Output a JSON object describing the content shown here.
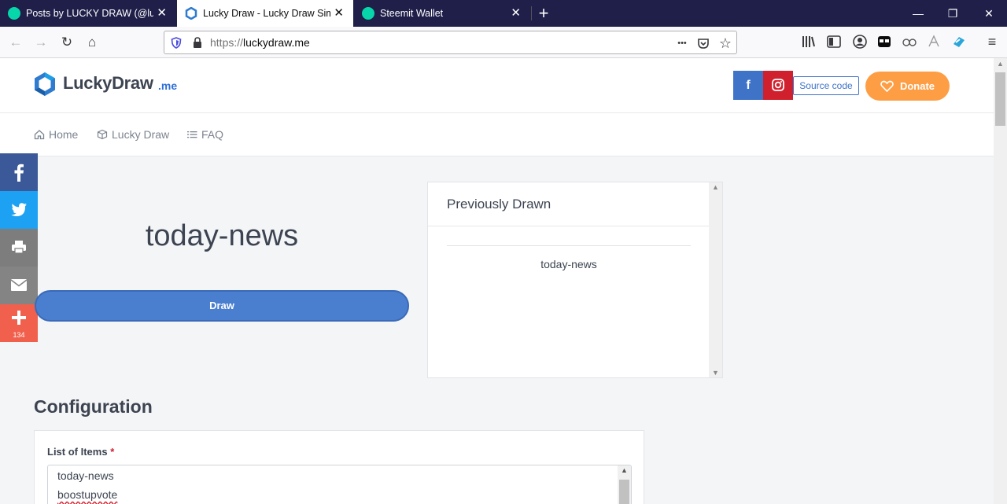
{
  "browser": {
    "tabs": [
      {
        "title": "Posts by LUCKY DRAW (@lucky",
        "close": "✕"
      },
      {
        "title": "Lucky Draw - Lucky Draw Simul",
        "close": "✕"
      },
      {
        "title": "Steemit Wallet",
        "close": "✕"
      }
    ],
    "new_tab": "+",
    "window_controls": {
      "minimize": "—",
      "restore": "❐",
      "close": "✕"
    },
    "nav": {
      "back": "←",
      "forward": "→",
      "reload": "↻",
      "home": "⌂"
    },
    "url": {
      "protocol": "https://",
      "host": "luckydraw.me"
    },
    "url_actions": {
      "more": "•••",
      "pocket": "◡",
      "bookmark": "☆"
    },
    "toolbar_icons": [
      "library-icon",
      "sidebar-icon",
      "account-icon",
      "extension-icon",
      "extension-icon",
      "extension-icon",
      "extension-icon"
    ],
    "menu": "≡"
  },
  "header": {
    "logo_text": "LuckyDraw",
    "logo_suffix": ".me",
    "facebook_label": "f",
    "source_code_label": "Source code",
    "donate_label": "Donate"
  },
  "menu": {
    "items": [
      {
        "label": "Home",
        "icon": "home-icon"
      },
      {
        "label": "Lucky Draw",
        "icon": "box-icon"
      },
      {
        "label": "FAQ",
        "icon": "list-icon"
      }
    ]
  },
  "share_bar": {
    "buttons": [
      {
        "name": "facebook",
        "color": "#3b5998"
      },
      {
        "name": "twitter",
        "color": "#1da1f2"
      },
      {
        "name": "print",
        "color": "#7d7d7d"
      },
      {
        "name": "email",
        "color": "#848484"
      },
      {
        "name": "more",
        "color": "#f0604d"
      }
    ],
    "count": "134"
  },
  "main": {
    "current_item": "today-news",
    "draw_button": "Draw"
  },
  "previously_drawn": {
    "title": "Previously Drawn",
    "items": [
      "today-news"
    ]
  },
  "configuration": {
    "title": "Configuration",
    "list_label": "List of Items",
    "required_mark": "*",
    "items": [
      "today-news",
      "boostupvote"
    ]
  },
  "colors": {
    "accent": "#3f73c8",
    "donate": "#fd9e45",
    "instagram": "#d0202d",
    "browser_dark": "#1f1f4a"
  }
}
